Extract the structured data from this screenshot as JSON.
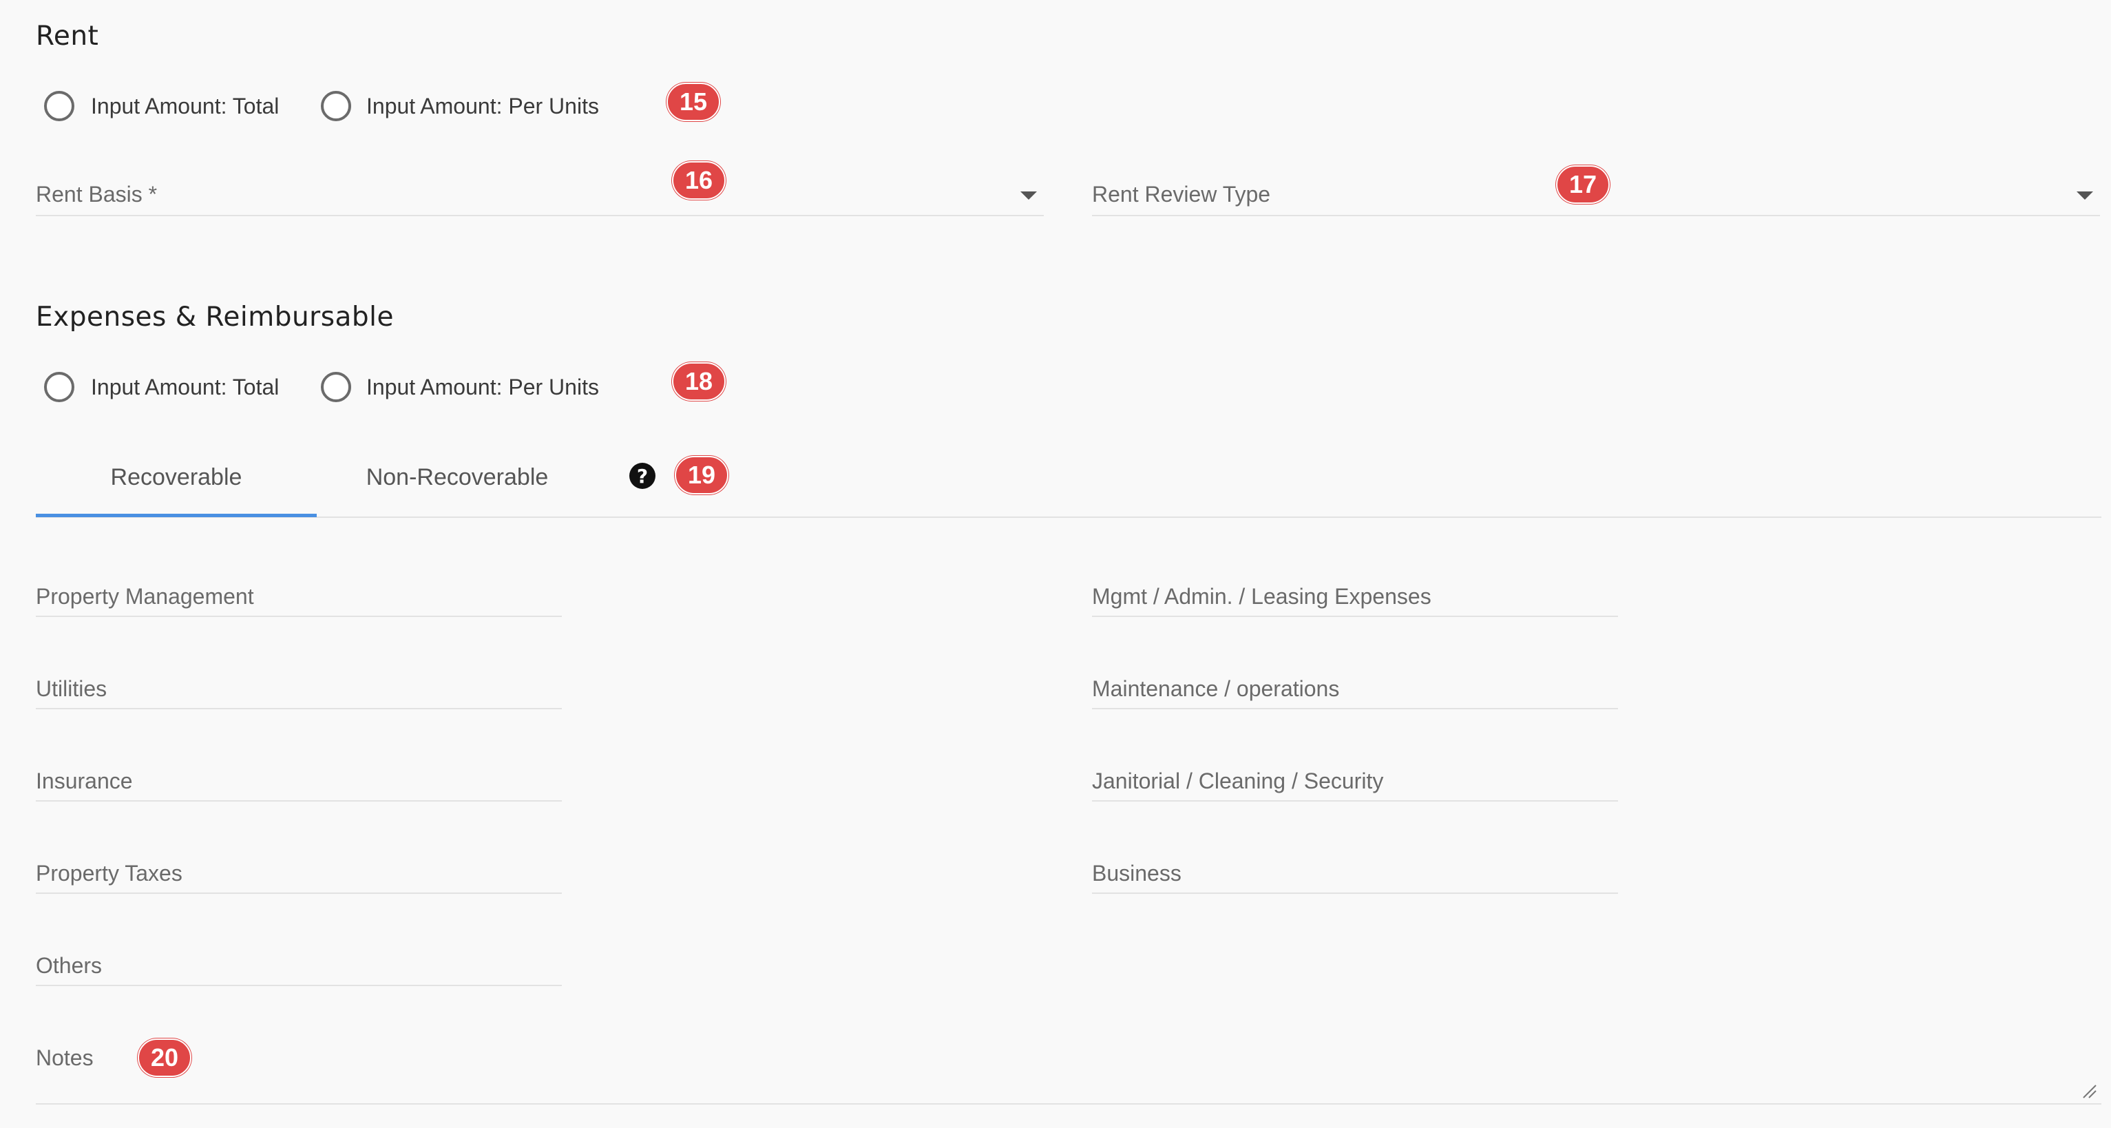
{
  "rent": {
    "heading": "Rent",
    "radio_total": "Input Amount: Total",
    "radio_per_units": "Input Amount: Per Units",
    "badge_radio": "15",
    "rent_basis_label": "Rent Basis *",
    "badge_rent_basis": "16",
    "rent_review_label": "Rent Review Type",
    "badge_rent_review": "17"
  },
  "expenses": {
    "heading": "Expenses & Reimbursable",
    "radio_total": "Input Amount: Total",
    "radio_per_units": "Input Amount: Per Units",
    "badge_radio": "18",
    "tabs": [
      "Recoverable",
      "Non-Recoverable"
    ],
    "active_tab": "Recoverable",
    "help_icon": "question-circle",
    "help_glyph": "?",
    "badge_tabs": "19",
    "left_fields": [
      "Property Management",
      "Utilities",
      "Insurance",
      "Property Taxes",
      "Others"
    ],
    "right_fields": [
      "Mgmt / Admin. / Leasing Expenses",
      "Maintenance / operations",
      "Janitorial / Cleaning / Security",
      "Business"
    ],
    "notes_label": "Notes",
    "badge_notes": "20"
  },
  "colors": {
    "badge": "#e04646",
    "active_tab_underline": "#4a90e2",
    "background": "#f9f9f9"
  }
}
